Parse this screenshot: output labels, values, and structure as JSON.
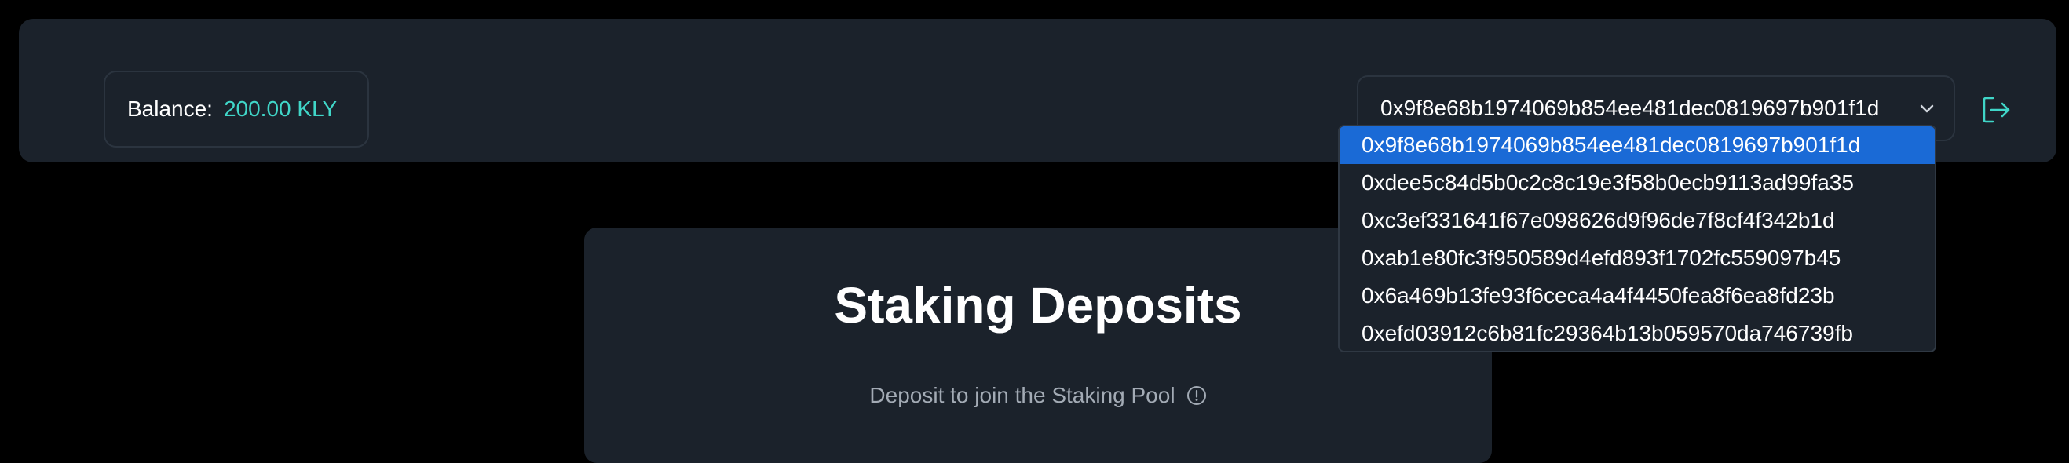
{
  "header": {
    "balance_label": "Balance:",
    "balance_value": "200.00 KLY",
    "selected_account": "0x9f8e68b1974069b854ee481dec0819697b901f1d",
    "logout_icon": "logout-icon"
  },
  "account_options": [
    "0x9f8e68b1974069b854ee481dec0819697b901f1d",
    "0xdee5c84d5b0c2c8c19e3f58b0ecb9113ad99fa35",
    "0xc3ef331641f67e098626d9f96de7f8cf4f342b1d",
    "0xab1e80fc3f950589d4efd893f1702fc559097b45",
    "0x6a469b13fe93f6ceca4a4f4450fea8f6ea8fd23b",
    "0xefd03912c6b81fc29364b13b059570da746739fb"
  ],
  "main": {
    "title": "Staking Deposits",
    "subtitle": "Deposit to join the Staking Pool"
  },
  "colors": {
    "accent": "#40d6c8",
    "panel": "#1b222b",
    "selected_option": "#1a6ad6"
  }
}
